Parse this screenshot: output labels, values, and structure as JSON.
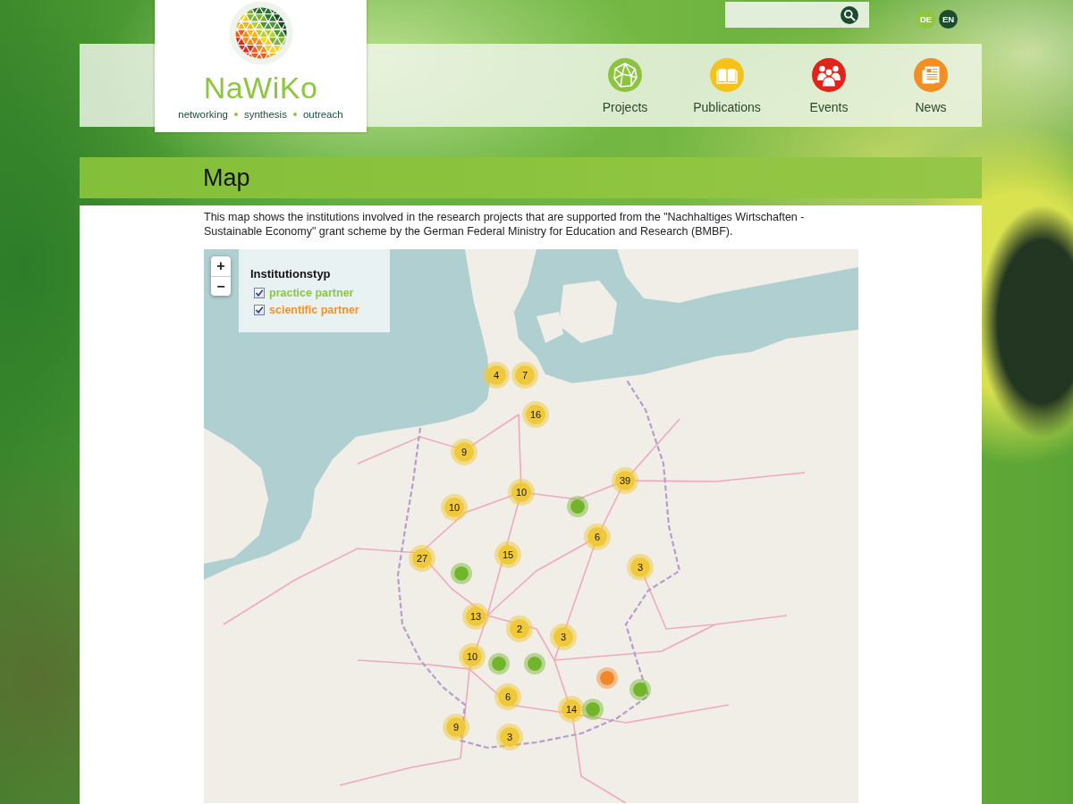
{
  "logo": {
    "name": "NaWiKo",
    "tagline": [
      "networking",
      "synthesis",
      "outreach"
    ]
  },
  "languages": [
    {
      "label": "DE",
      "selected": false
    },
    {
      "label": "EN",
      "selected": true
    }
  ],
  "nav": [
    {
      "label": "Projects",
      "color": "#8cc43f"
    },
    {
      "label": "Publications",
      "color": "#f5c21b"
    },
    {
      "label": "Events",
      "color": "#e2231a"
    },
    {
      "label": "News",
      "color": "#f18f22"
    }
  ],
  "page_title": "Map",
  "description": "This map shows the institutions involved in the research projects that are supported from the \"Nachhaltiges Wirtschaften - Sustainable Economy\" grant scheme by the German Federal Ministry for Education and Research (BMBF).",
  "map": {
    "zoom_controls": [
      "+",
      "−"
    ],
    "legend": {
      "title": "Institutionstyp",
      "items": [
        {
          "label": "practice partner",
          "checked": true,
          "color": "#8dc63f"
        },
        {
          "label": "scientific partner",
          "checked": true,
          "color": "#f0922e"
        }
      ]
    },
    "markers": [
      {
        "kind": "cluster",
        "count": "4",
        "color": "#f0c93a"
      },
      {
        "kind": "cluster",
        "count": "7",
        "color": "#f0c93a"
      },
      {
        "kind": "cluster",
        "count": "16",
        "color": "#f0c93a"
      },
      {
        "kind": "cluster",
        "count": "9",
        "color": "#f0c93a"
      },
      {
        "kind": "cluster",
        "count": "10",
        "color": "#f0c93a"
      },
      {
        "kind": "cluster",
        "count": "39",
        "color": "#f0c93a"
      },
      {
        "kind": "cluster",
        "count": "10",
        "color": "#f0c93a"
      },
      {
        "kind": "pin",
        "color": "#72b42a"
      },
      {
        "kind": "cluster",
        "count": "6",
        "color": "#f0c93a"
      },
      {
        "kind": "cluster",
        "count": "15",
        "color": "#f0c93a"
      },
      {
        "kind": "cluster",
        "count": "27",
        "color": "#f0c93a"
      },
      {
        "kind": "cluster",
        "count": "3",
        "color": "#f0c93a"
      },
      {
        "kind": "pin",
        "color": "#72b42a"
      },
      {
        "kind": "cluster",
        "count": "13",
        "color": "#f0c93a"
      },
      {
        "kind": "cluster",
        "count": "2",
        "color": "#f0c93a"
      },
      {
        "kind": "cluster",
        "count": "3",
        "color": "#f0c93a"
      },
      {
        "kind": "cluster",
        "count": "10",
        "color": "#f0c93a"
      },
      {
        "kind": "pin",
        "color": "#72b42a"
      },
      {
        "kind": "pin",
        "color": "#72b42a"
      },
      {
        "kind": "pin",
        "color": "#f0882a"
      },
      {
        "kind": "pin",
        "color": "#72b42a"
      },
      {
        "kind": "cluster",
        "count": "6",
        "color": "#f0c93a"
      },
      {
        "kind": "cluster",
        "count": "14",
        "color": "#f0c93a"
      },
      {
        "kind": "pin",
        "color": "#72b42a"
      },
      {
        "kind": "cluster",
        "count": "9",
        "color": "#f0c93a"
      },
      {
        "kind": "cluster",
        "count": "3",
        "color": "#f0c93a"
      }
    ]
  }
}
